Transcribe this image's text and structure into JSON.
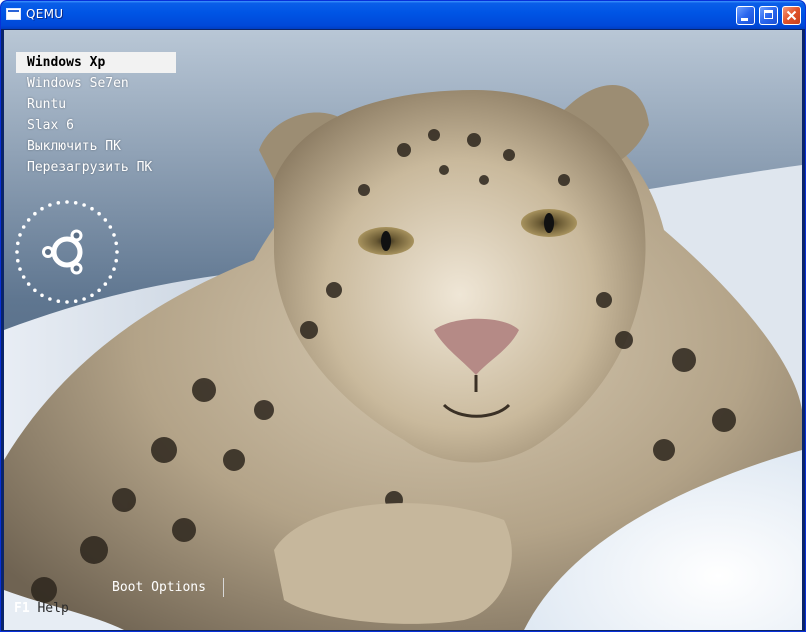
{
  "window": {
    "title": "QEMU",
    "buttons": [
      "minimize",
      "maximize",
      "close"
    ]
  },
  "boot_menu": {
    "items": [
      {
        "label": "Windows Xp",
        "selected": true
      },
      {
        "label": "Windows Se7en",
        "selected": false
      },
      {
        "label": "Runtu",
        "selected": false
      },
      {
        "label": "Slax 6",
        "selected": false
      },
      {
        "label": "Выключить ПК",
        "selected": false
      },
      {
        "label": "Перезагрузить ПК",
        "selected": false
      }
    ]
  },
  "footer": {
    "boot_options_label": "Boot Options",
    "help_key": "F1",
    "help_label": "Help"
  },
  "icons": {
    "window_icon": "qemu-window-icon",
    "logo": "ubuntu-logo-icon"
  },
  "colors": {
    "titlebar": "#0055e5",
    "close_button": "#e0522a",
    "menu_highlight": "#f2f2f2",
    "menu_text": "#ffffff"
  }
}
